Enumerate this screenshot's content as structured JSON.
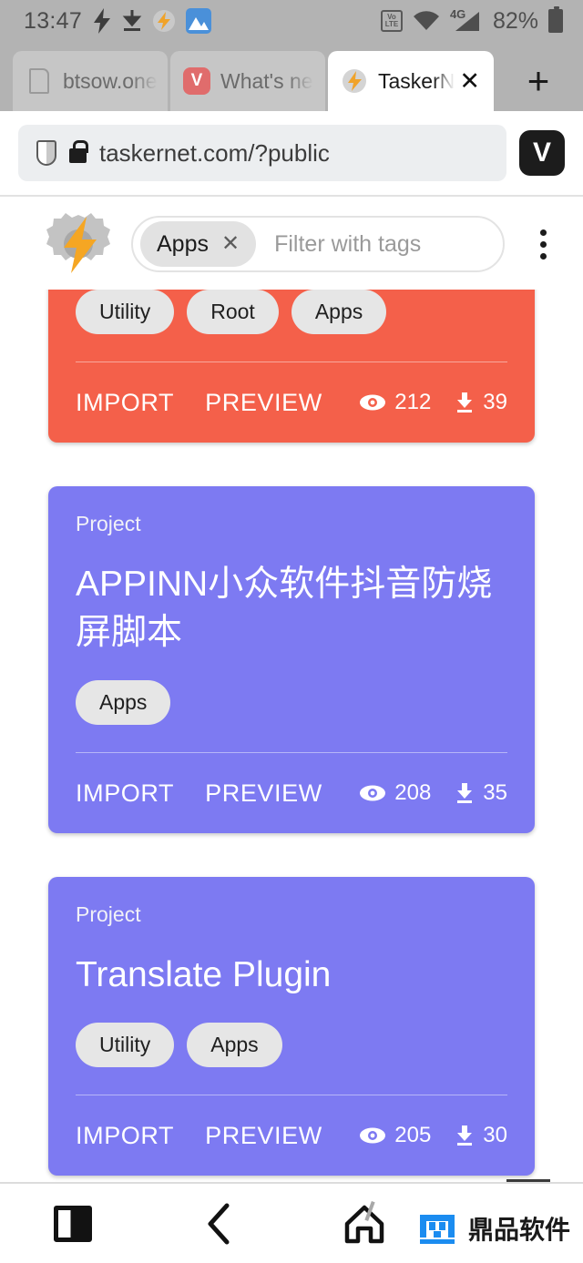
{
  "status_bar": {
    "time": "13:47",
    "icons": [
      "lightning-bolt-icon",
      "download-icon",
      "tasker-icon",
      "gallery-icon"
    ],
    "volte_top": "Vo",
    "volte_bottom": "LTE",
    "network": "4G",
    "battery_percent": "82%"
  },
  "browser": {
    "tabs": [
      {
        "title": "btsow.one",
        "favicon": "document-icon",
        "active": false
      },
      {
        "title": "What's ne",
        "favicon": "vivaldi-icon",
        "active": false
      },
      {
        "title": "TaskerN",
        "favicon": "tasker-icon",
        "active": true
      }
    ],
    "new_tab_label": "+",
    "close_label": "✕",
    "address": {
      "url": "taskernet.com/?public",
      "shield_icon": "shield-icon",
      "lock_icon": "lock-icon"
    },
    "vivaldi_button": "V"
  },
  "tasker_header": {
    "logo": "tasker-gear-logo",
    "active_tag": "Apps",
    "remove_tag_label": "✕",
    "filter_placeholder": "Filter with tags",
    "overflow_menu": "kebab-menu-icon"
  },
  "cards": [
    {
      "color": "#f4604a",
      "kind": "",
      "title": "",
      "tags": [
        "Utility",
        "Root",
        "Apps"
      ],
      "import_label": "IMPORT",
      "preview_label": "PREVIEW",
      "views": "212",
      "downloads": "39",
      "clipped_top": true
    },
    {
      "color": "#7d7af2",
      "kind": "Project",
      "title": "APPINN小众软件抖音防烧屏脚本",
      "tags": [
        "Apps"
      ],
      "import_label": "IMPORT",
      "preview_label": "PREVIEW",
      "views": "208",
      "downloads": "35",
      "clipped_top": false
    },
    {
      "color": "#7d7af2",
      "kind": "Project",
      "title": "Translate Plugin",
      "tags": [
        "Utility",
        "Apps"
      ],
      "import_label": "IMPORT",
      "preview_label": "PREVIEW",
      "views": "205",
      "downloads": "30",
      "clipped_top": false
    }
  ],
  "nav_bar": {
    "items": [
      "recents-icon",
      "back-icon",
      "home-icon"
    ]
  },
  "watermark": {
    "text": "鼎品软件",
    "color": "#1b8cf0"
  }
}
